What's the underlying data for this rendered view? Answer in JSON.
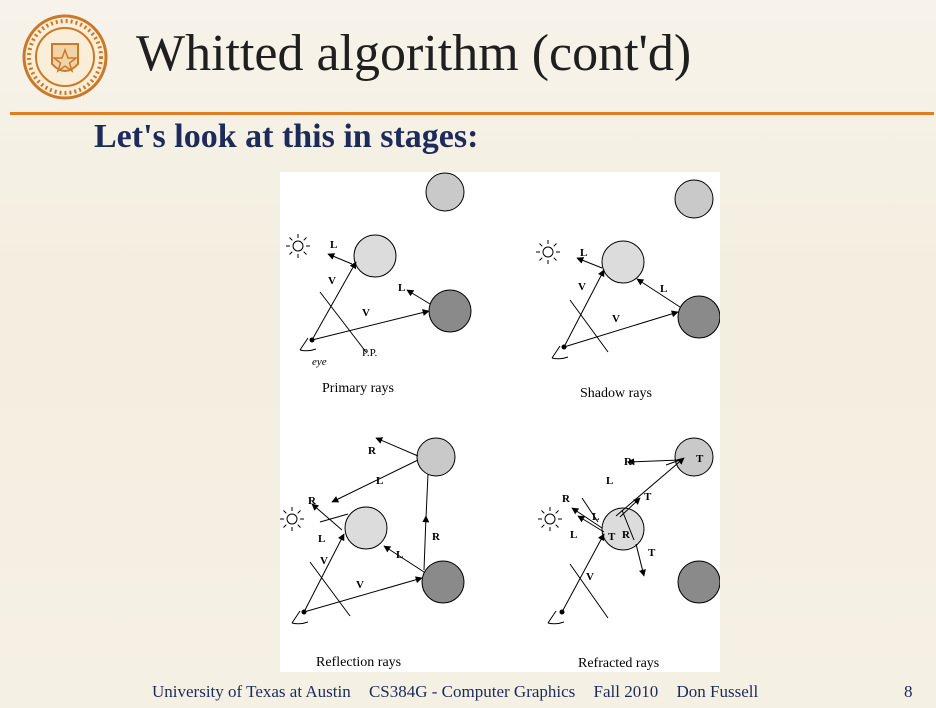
{
  "slide": {
    "title": "Whitted algorithm (cont'd)",
    "subtitle": "Let's look at this in stages:",
    "seal_text": "THE UNIVERSITY OF TEXAS AT AUSTIN"
  },
  "figure": {
    "captions": {
      "primary": "Primary rays",
      "shadow": "Shadow rays",
      "reflection": "Reflection rays",
      "refracted": "Refracted rays"
    },
    "labels": {
      "eye": "eye",
      "pp": "P.P.",
      "L": "L",
      "V": "V",
      "R": "R",
      "T": "T"
    }
  },
  "footer": {
    "institution": "University of Texas at Austin",
    "course": "CS384G  -  Computer Graphics",
    "term": "Fall 2010",
    "author": "Don Fussell",
    "page": "8"
  }
}
